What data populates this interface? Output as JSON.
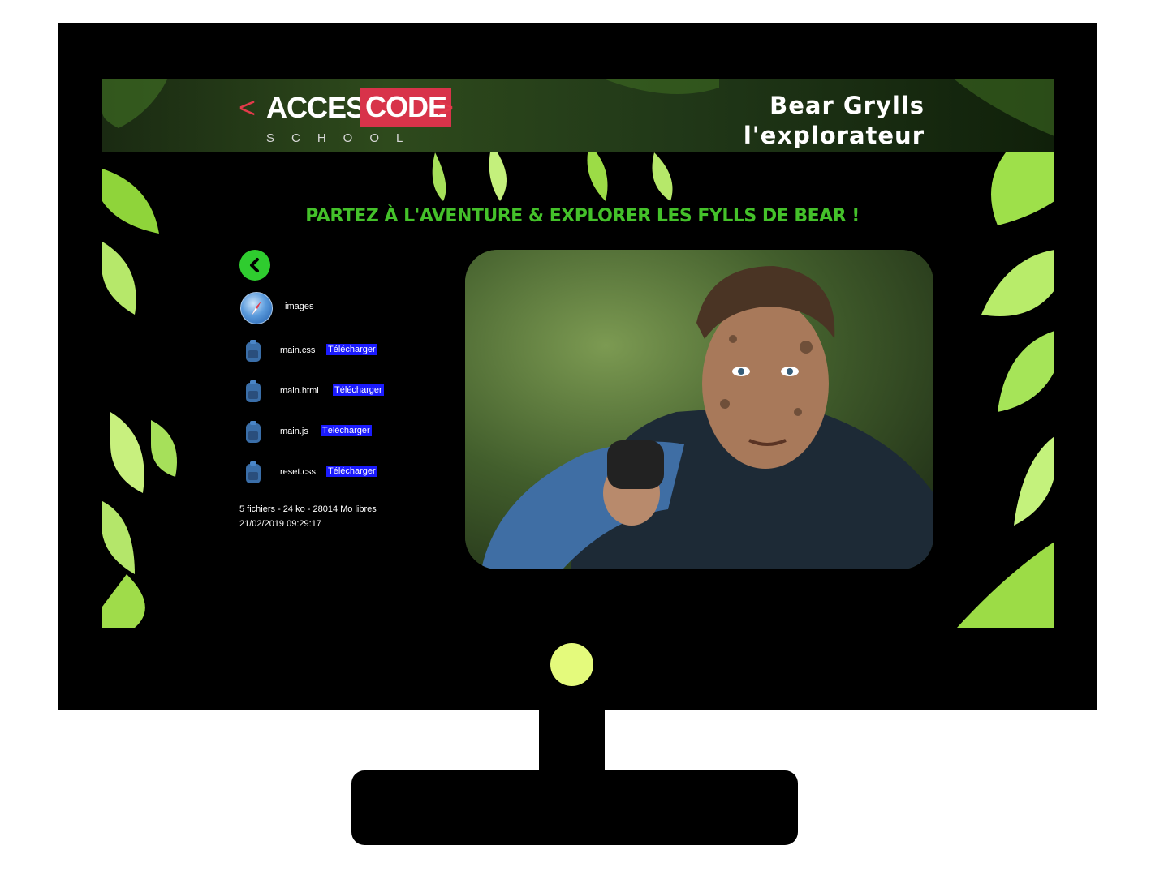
{
  "header": {
    "logo": {
      "bracket_left": "<",
      "access": "ACCESS",
      "code": "CODE",
      "bracket_right": ">",
      "school": "SCHOOL"
    },
    "title_line1": "Bear Grylls",
    "title_line2": "l'explorateur"
  },
  "main": {
    "tagline": "PARTEZ À L'AVENTURE & EXPLORER LES FYLLS DE BEAR !"
  },
  "browser": {
    "back_icon": "chevron-left-icon",
    "folder": {
      "label": "images",
      "icon": "compass-folder-icon"
    },
    "files": [
      {
        "name": "main.css",
        "download": "Télécharger"
      },
      {
        "name": "main.html",
        "download": "Télécharger"
      },
      {
        "name": "main.js",
        "download": "Télécharger"
      },
      {
        "name": "reset.css",
        "download": "Télécharger"
      }
    ],
    "stats_line1": "5 fichiers - 24 ko - 28014 Mo libres",
    "stats_line2": "21/02/2019 09:29:17"
  },
  "colors": {
    "accent_green": "#44c12a",
    "logo_red": "#d8334a",
    "link_bg": "#1b1bff",
    "power_led": "#e4fa7c"
  }
}
